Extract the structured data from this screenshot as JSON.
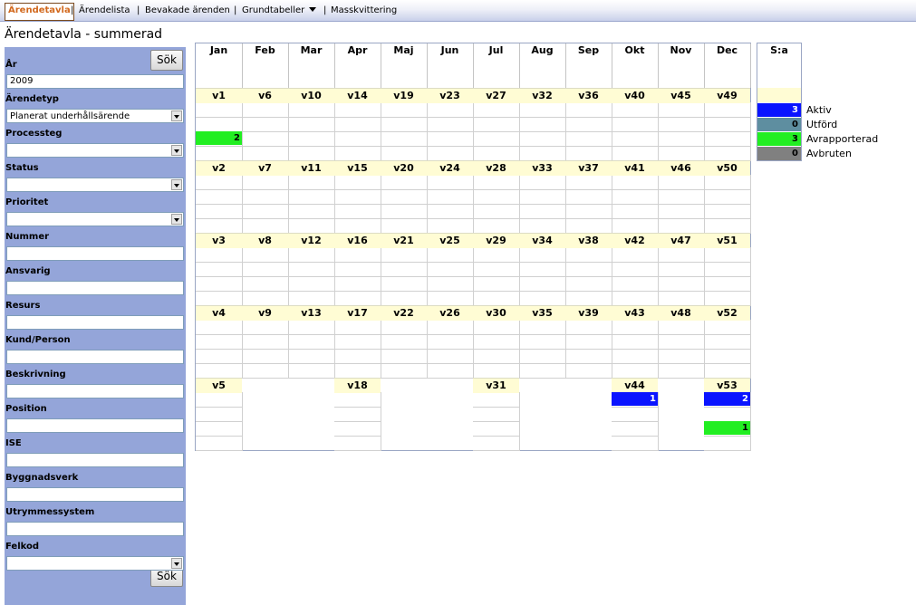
{
  "nav": {
    "items": [
      {
        "label": "Ärendetavla",
        "active": true
      },
      {
        "label": "Ärendelista"
      },
      {
        "label": "Bevakade ärenden"
      },
      {
        "label": "Grundtabeller",
        "dropdown": true
      },
      {
        "label": "Masskvittering"
      }
    ],
    "separator": "|"
  },
  "page_title": "Ärendetavla - summerad",
  "sidebar": {
    "search_label": "Sök",
    "fields": [
      {
        "label": "År",
        "type": "input",
        "value": "2009"
      },
      {
        "label": "Ärendetyp",
        "type": "select",
        "value": "Planerat underhållsärende"
      },
      {
        "label": "Processteg",
        "type": "select",
        "value": ""
      },
      {
        "label": "Status",
        "type": "select",
        "value": ""
      },
      {
        "label": "Prioritet",
        "type": "select",
        "value": ""
      },
      {
        "label": "Nummer",
        "type": "input",
        "value": ""
      },
      {
        "label": "Ansvarig",
        "type": "input",
        "value": ""
      },
      {
        "label": "Resurs",
        "type": "input",
        "value": ""
      },
      {
        "label": "Kund/Person",
        "type": "input",
        "value": ""
      },
      {
        "label": "Beskrivning",
        "type": "input",
        "value": ""
      },
      {
        "label": "Position",
        "type": "input",
        "value": ""
      },
      {
        "label": "ISE",
        "type": "input",
        "value": ""
      },
      {
        "label": "Byggnadsverk",
        "type": "input",
        "value": ""
      },
      {
        "label": "Utrymmessystem",
        "type": "input",
        "value": ""
      },
      {
        "label": "Felkod",
        "type": "select",
        "value": ""
      }
    ]
  },
  "calendar": {
    "months": [
      "Jan",
      "Feb",
      "Mar",
      "Apr",
      "Maj",
      "Jun",
      "Jul",
      "Aug",
      "Sep",
      "Okt",
      "Nov",
      "Dec"
    ],
    "week_rows": [
      [
        "v1",
        "v6",
        "v10",
        "v14",
        "v19",
        "v23",
        "v27",
        "v32",
        "v36",
        "v40",
        "v45",
        "v49"
      ],
      [
        "v2",
        "v7",
        "v11",
        "v15",
        "v20",
        "v24",
        "v28",
        "v33",
        "v37",
        "v41",
        "v46",
        "v50"
      ],
      [
        "v3",
        "v8",
        "v12",
        "v16",
        "v21",
        "v25",
        "v29",
        "v34",
        "v38",
        "v42",
        "v47",
        "v51"
      ],
      [
        "v4",
        "v9",
        "v13",
        "v17",
        "v22",
        "v26",
        "v30",
        "v35",
        "v39",
        "v43",
        "v48",
        "v52"
      ],
      [
        "v5",
        null,
        null,
        "v18",
        null,
        null,
        "v31",
        null,
        null,
        "v44",
        null,
        "v53"
      ]
    ],
    "counts": [
      {
        "row": 0,
        "col": 0,
        "status": "Avrapporterad",
        "value": "2"
      },
      {
        "row": 4,
        "col": 9,
        "status": "Aktiv",
        "value": "1"
      },
      {
        "row": 4,
        "col": 11,
        "status": "Aktiv",
        "value": "2"
      },
      {
        "row": 4,
        "col": 11,
        "status": "Avrapporterad",
        "value": "1"
      }
    ]
  },
  "summary": {
    "header": "S:a",
    "statuses": [
      {
        "name": "Aktiv",
        "count": "3",
        "color": "#0a14ff"
      },
      {
        "name": "Utförd",
        "count": "0",
        "color": "#5e8ea0"
      },
      {
        "name": "Avrapporterad",
        "count": "3",
        "color": "#22ee22"
      },
      {
        "name": "Avbruten",
        "count": "0",
        "color": "#808080"
      }
    ]
  }
}
